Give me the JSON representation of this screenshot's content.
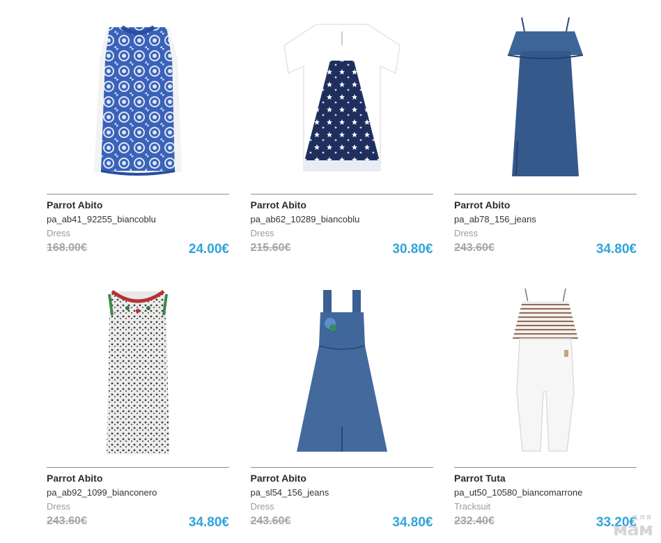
{
  "products": [
    {
      "brand": "Parrot Abito",
      "sku": "pa_ab41_92255_biancoblu",
      "category": "Dress",
      "old_price": "168.00€",
      "new_price": "24.00€",
      "image_icon": "lace-dress-image"
    },
    {
      "brand": "Parrot Abito",
      "sku": "pa_ab62_10289_biancoblu",
      "category": "Dress",
      "old_price": "215.60€",
      "new_price": "30.80€",
      "image_icon": "star-dress-image"
    },
    {
      "brand": "Parrot Abito",
      "sku": "pa_ab78_156_jeans",
      "category": "Dress",
      "old_price": "243.60€",
      "new_price": "34.80€",
      "image_icon": "denim-slip-dress-image"
    },
    {
      "brand": "Parrot Abito",
      "sku": "pa_ab92_1099_bianconero",
      "category": "Dress",
      "old_price": "243.60€",
      "new_price": "34.80€",
      "image_icon": "print-dress-image"
    },
    {
      "brand": "Parrot Abito",
      "sku": "pa_sl54_156_jeans",
      "category": "Dress",
      "old_price": "243.60€",
      "new_price": "34.80€",
      "image_icon": "denim-pinafore-image"
    },
    {
      "brand": "Parrot Tuta",
      "sku": "pa_ut50_10580_biancomarrone",
      "category": "Tracksuit",
      "old_price": "232.40€",
      "new_price": "33.20€",
      "image_icon": "jumpsuit-image"
    }
  ],
  "colors": {
    "price_accent": "#2fa4dc",
    "old_price": "#a5a5a5",
    "category": "#9a9a9a"
  },
  "watermark": {
    "line1": "для",
    "line2": "мам"
  }
}
